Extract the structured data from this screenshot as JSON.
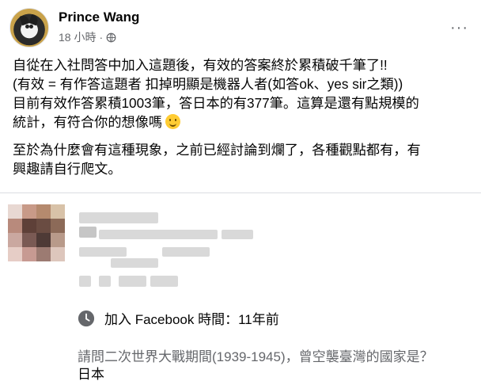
{
  "post": {
    "author": "Prince Wang",
    "time": "18 小時",
    "separator": "·",
    "visibility_icon": "globe-icon",
    "more_icon": "more-options-icon",
    "more_label": "···",
    "body": {
      "line1": "自從在入社問答中加入這題後，有效的答案終於累積破千筆了!!",
      "line2": "(有效 = 有作答這題者 扣掉明顯是機器人者(如答ok、yes sir之類))",
      "line3": "目前有效作答累積1003筆，答日本的有377筆。這算是還有點規模的",
      "line4": "統計，有符合你的想像嗎",
      "emoji": "smile-emoji-icon",
      "para2_line1": "至於為什麼會有這種現象，之前已經討論到爛了，各種觀點都有，有",
      "para2_line2": "興趣請自行爬文。"
    }
  },
  "comment": {
    "join_info": "加入 Facebook 時間：11年前",
    "join_icon": "clock-icon",
    "question": "請問二次世界大戰期間(1939-1945)，曾空襲臺灣的國家是？",
    "answer": "日本"
  },
  "colors": {
    "text": "#050505",
    "secondary": "#65676b",
    "divider": "#dadde1",
    "blur": "#d9d9d9"
  }
}
